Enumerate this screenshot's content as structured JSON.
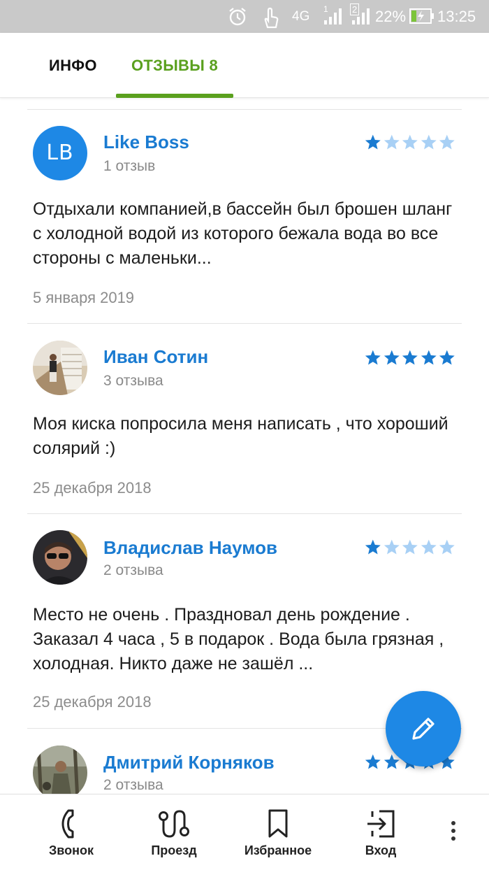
{
  "status_bar": {
    "network": "4G",
    "sim1": "1",
    "sim2": "2",
    "battery": "22%",
    "time": "13:25"
  },
  "tabs": [
    {
      "label": "ИНФО",
      "active": false
    },
    {
      "label": "ОТЗЫВЫ 8",
      "active": true
    }
  ],
  "colors": {
    "accent_green": "#5aa01e",
    "link_blue": "#1a7bd1",
    "fab_blue": "#1e88e5",
    "star_filled": "#1a7bd1",
    "star_empty": "#a8d0f5"
  },
  "reviews": [
    {
      "initials": "LB",
      "name": "Like Boss",
      "count": "1 отзыв",
      "rating": 1,
      "text": "Отдыхали компанией,в бассейн был брошен шланг с холодной водой из которого бежала вода во все стороны с маленьки...",
      "date": "5 января 2019"
    },
    {
      "name": "Иван Сотин",
      "count": "3 отзыва",
      "rating": 5,
      "text": "Моя киска попросила меня написать , что хороший солярий :)",
      "date": "25 декабря 2018"
    },
    {
      "name": "Владислав Наумов",
      "count": "2 отзыва",
      "rating": 1,
      "text": "Место не очень . Праздновал день рождение . Заказал 4 часа , 5 в подарок . Вода была грязная , холодная. Никто даже не зашёл ...",
      "date": "25 декабря 2018"
    },
    {
      "name": "Дмитрий Корняков",
      "count": "2 отзыва",
      "rating": 5
    }
  ],
  "fab": {
    "icon": "pencil-icon"
  },
  "bottom_nav": [
    {
      "label": "Звонок",
      "icon": "phone-icon"
    },
    {
      "label": "Проезд",
      "icon": "route-icon"
    },
    {
      "label": "Избранное",
      "icon": "bookmark-icon"
    },
    {
      "label": "Вход",
      "icon": "login-icon"
    }
  ]
}
